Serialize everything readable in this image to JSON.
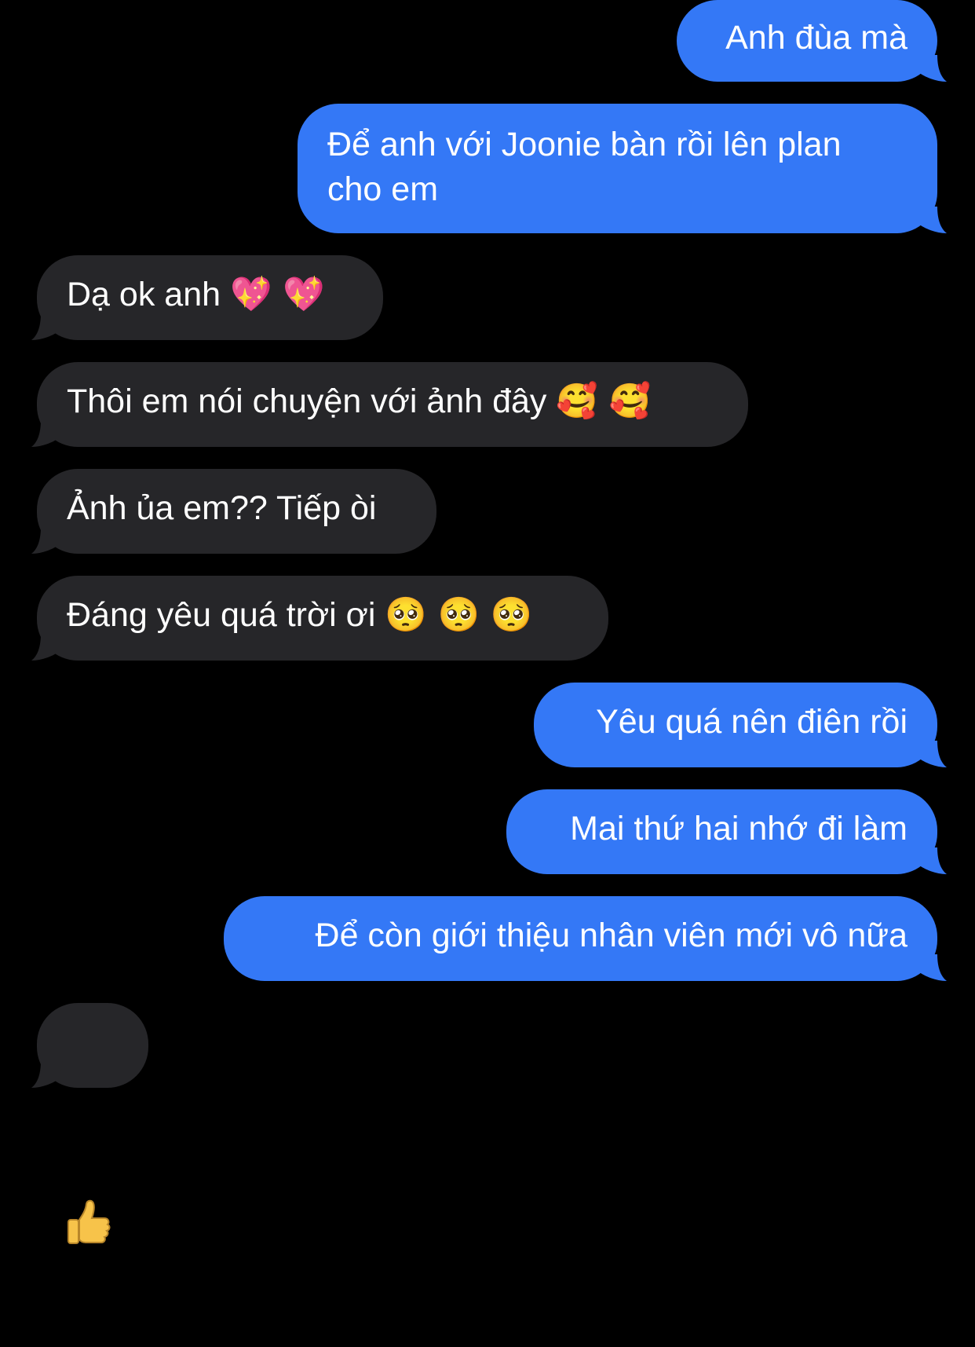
{
  "colors": {
    "background": "#000000",
    "sent_bubble": "#3478f6",
    "received_bubble": "#262629",
    "text": "#ffffff"
  },
  "messages": [
    {
      "direction": "sent",
      "text": "Anh đùa mà"
    },
    {
      "direction": "sent",
      "text": "Để anh với Joonie bàn rồi lên plan\ncho em"
    },
    {
      "direction": "received",
      "text": "Dạ ok anh",
      "emoji": "💖 💖",
      "emoji_name": "sparkling-heart"
    },
    {
      "direction": "received",
      "text": "Thôi em nói chuyện với ảnh đây",
      "emoji": "🥰 🥰",
      "emoji_name": "smiling-face-with-hearts"
    },
    {
      "direction": "received",
      "text": "Ảnh ủa em?? Tiếp òi"
    },
    {
      "direction": "received",
      "text": "Đáng yêu quá trời ơi",
      "emoji": "🥺 🥺 🥺",
      "emoji_name": "pleading-face"
    },
    {
      "direction": "sent",
      "text": "Yêu quá nên điên rồi"
    },
    {
      "direction": "sent",
      "text": "Mai thứ hai nhớ đi làm"
    },
    {
      "direction": "sent",
      "text": "Để còn giới thiệu nhân viên mới vô nữa"
    },
    {
      "direction": "received",
      "emoji": "👍",
      "emoji_name": "thumbs-up"
    }
  ]
}
